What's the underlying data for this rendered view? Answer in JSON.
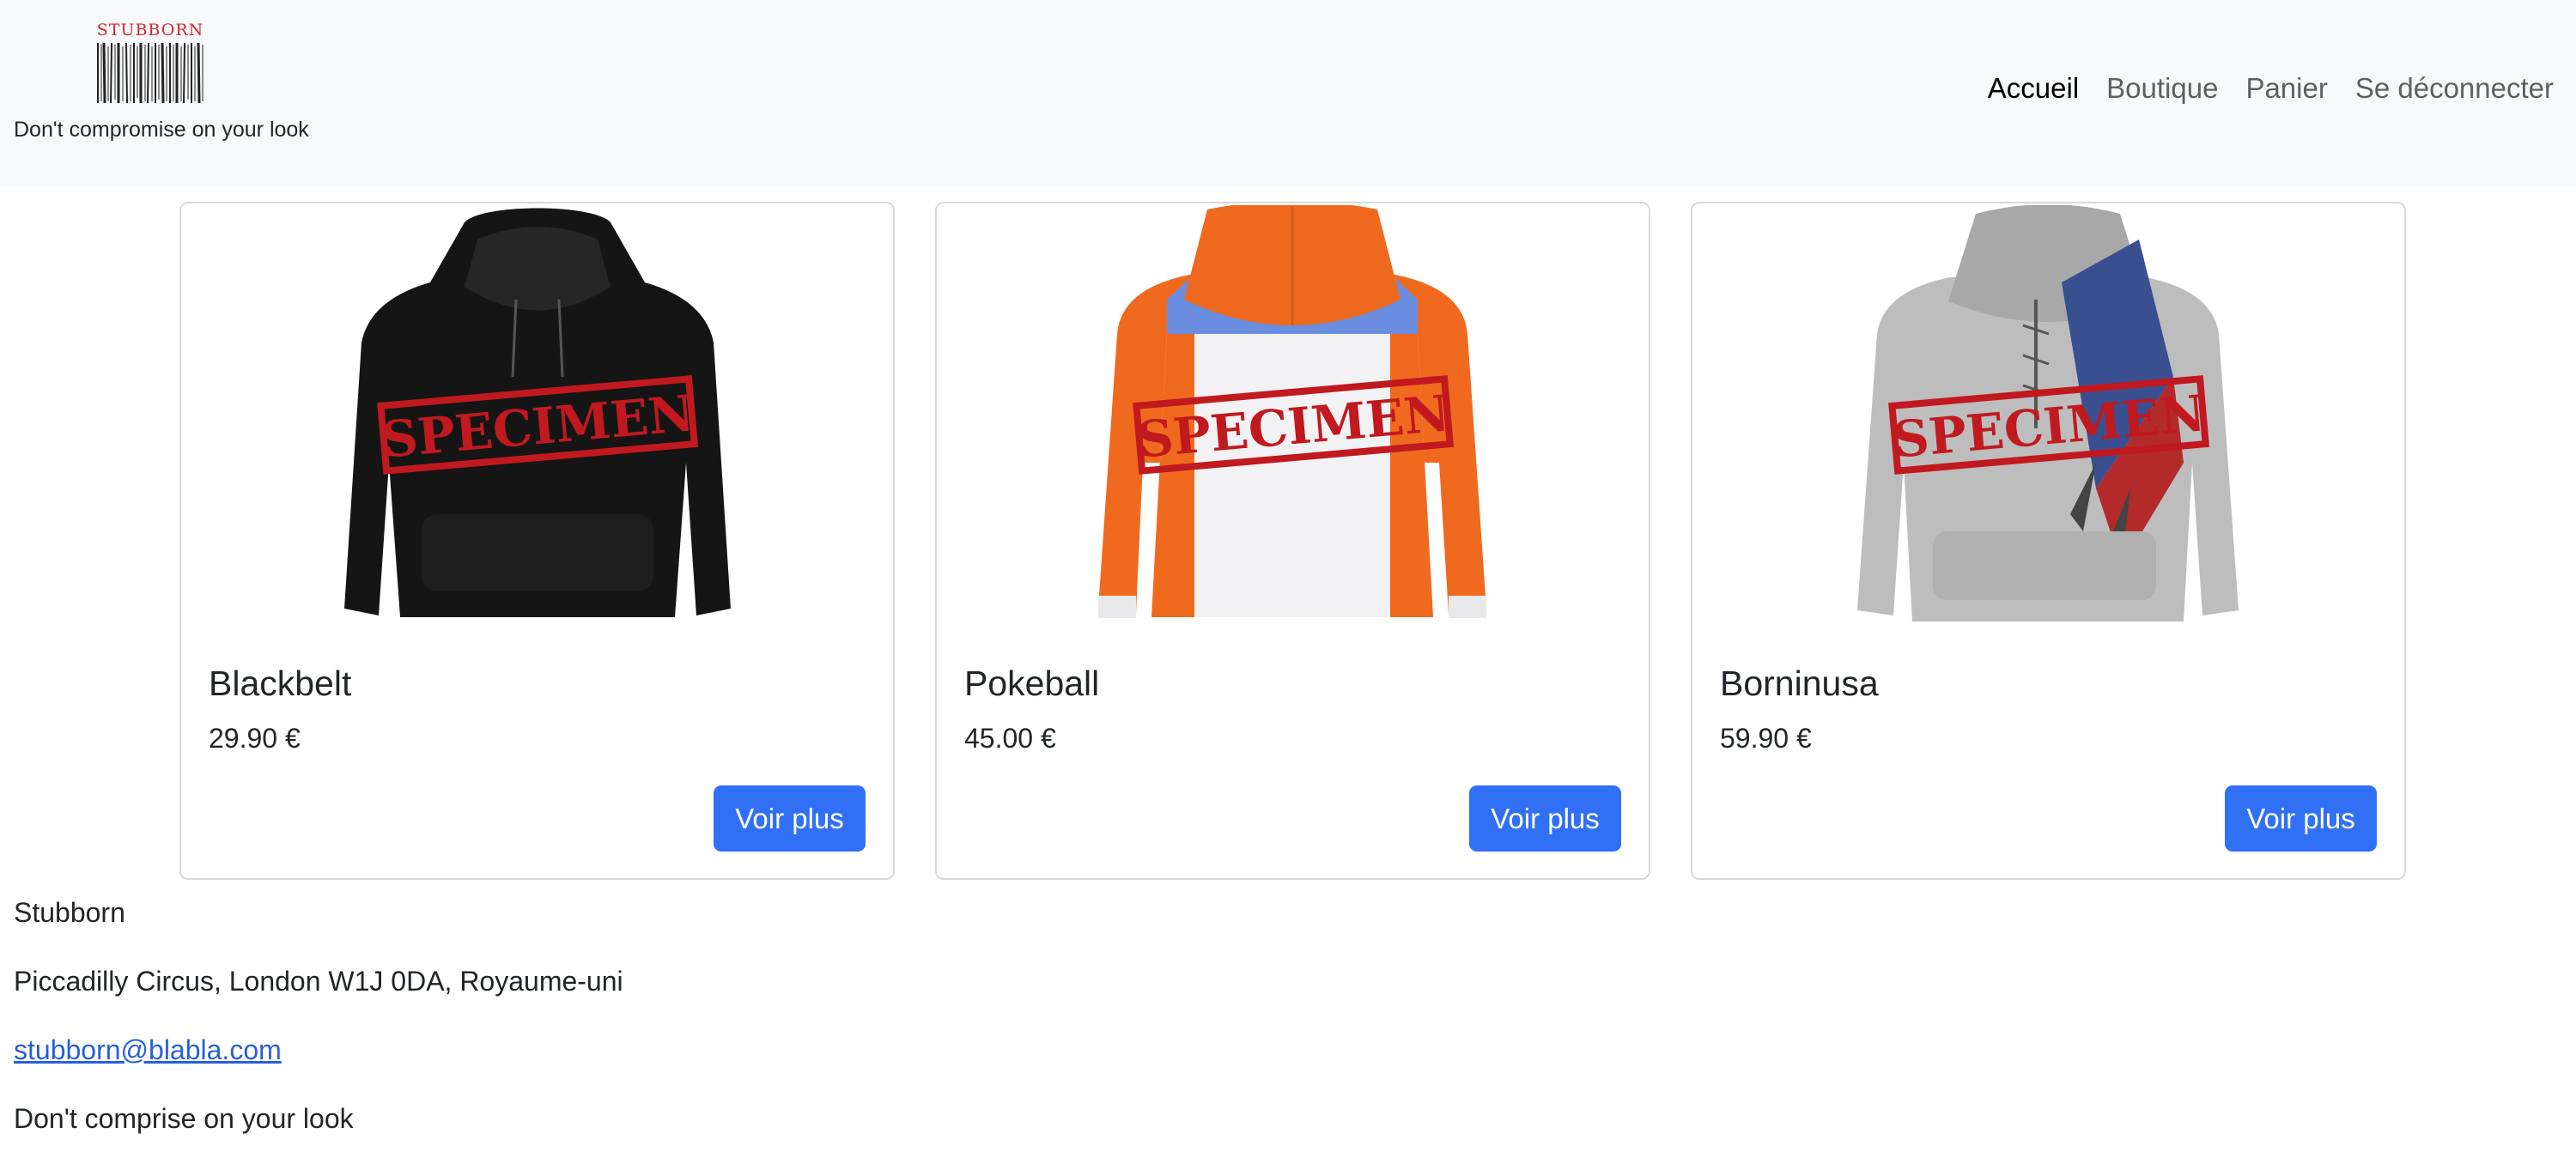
{
  "brand": {
    "logo_text": "STUBBORN",
    "tagline": "Don't compromise on your look"
  },
  "nav": {
    "items": [
      {
        "label": "Accueil",
        "active": true
      },
      {
        "label": "Boutique",
        "active": false
      },
      {
        "label": "Panier",
        "active": false
      },
      {
        "label": "Se déconnecter",
        "active": false
      }
    ]
  },
  "products": [
    {
      "name": "Blackbelt",
      "price": "29.90 €",
      "button": "Voir plus",
      "stamp": "SPECIMEN"
    },
    {
      "name": "Pokeball",
      "price": "45.00 €",
      "button": "Voir plus",
      "stamp": "SPECIMEN"
    },
    {
      "name": "Borninusa",
      "price": "59.90 €",
      "button": "Voir plus",
      "stamp": "SPECIMEN"
    }
  ],
  "footer": {
    "company": "Stubborn",
    "address": "Piccadilly Circus, London W1J 0DA, Royaume-uni",
    "email": "stubborn@blabla.com",
    "slogan": "Don't comprise on your look"
  },
  "colors": {
    "navbar_bg": "#f8f9fa",
    "button_bg": "#3170f5",
    "link": "#2860d8",
    "stamp_red": "#c0191f",
    "logo_red": "#d9232d"
  }
}
